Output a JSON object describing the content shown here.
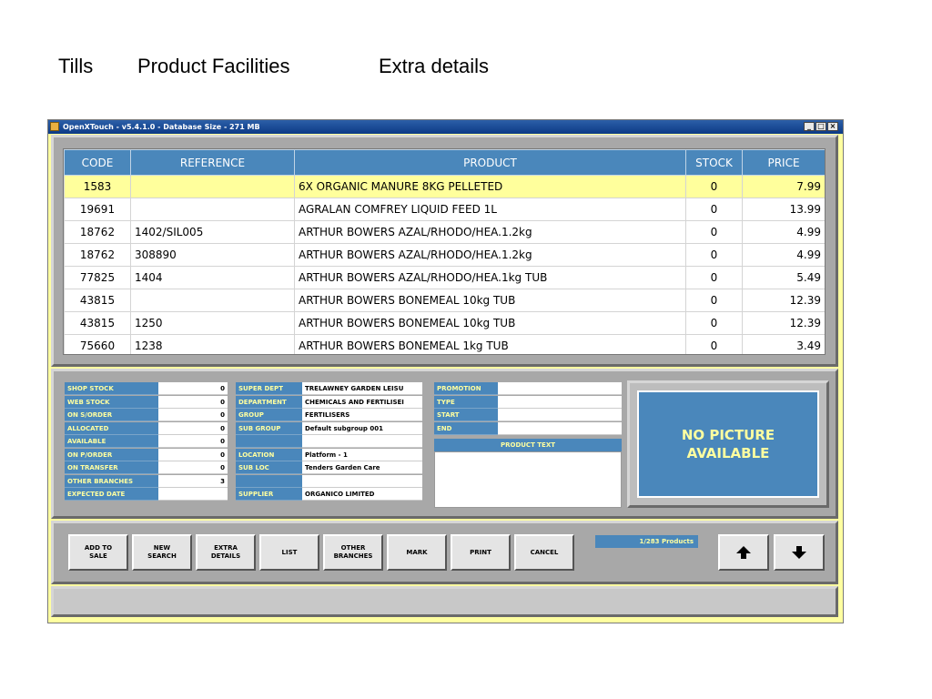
{
  "slide_tabs": [
    "Tills",
    "Product Facilities",
    "Extra details"
  ],
  "window": {
    "title": "OpenXTouch - v5.4.1.0 - Database Size - 271 MB",
    "controls": {
      "minimize": "_",
      "maximize": "□",
      "close": "×"
    }
  },
  "grid": {
    "columns": [
      "CODE",
      "REFERENCE",
      "PRODUCT",
      "STOCK",
      "PRICE"
    ],
    "selected_row": 0,
    "rows": [
      [
        "1583",
        "",
        "6X ORGANIC MANURE 8KG PELLETED",
        "0",
        "7.99"
      ],
      [
        "19691",
        "",
        "AGRALAN COMFREY LIQUID FEED 1L",
        "0",
        "13.99"
      ],
      [
        "18762",
        "1402/SIL005",
        "ARTHUR BOWERS AZAL/RHODO/HEA.1.2kg",
        "0",
        "4.99"
      ],
      [
        "18762",
        "308890",
        "ARTHUR BOWERS AZAL/RHODO/HEA.1.2kg",
        "0",
        "4.99"
      ],
      [
        "77825",
        "1404",
        "ARTHUR BOWERS AZAL/RHODO/HEA.1kg TUB",
        "0",
        "5.49"
      ],
      [
        "43815",
        "",
        "ARTHUR BOWERS BONEMEAL 10kg TUB",
        "0",
        "12.39"
      ],
      [
        "43815",
        "1250",
        "ARTHUR BOWERS BONEMEAL 10kg TUB",
        "0",
        "12.39"
      ],
      [
        "75660",
        "1238",
        "ARTHUR BOWERS BONEMEAL 1kg TUB",
        "0",
        "3.49"
      ]
    ]
  },
  "stock": [
    {
      "label": "SHOP STOCK",
      "value": "0"
    },
    {
      "label": "WEB STOCK",
      "value": "0"
    },
    {
      "label": "ON S/ORDER",
      "value": "0"
    },
    {
      "label": "ALLOCATED",
      "value": "0"
    },
    {
      "label": "AVAILABLE",
      "value": "0"
    },
    {
      "label": "ON P/ORDER",
      "value": "0"
    },
    {
      "label": "ON TRANSFER",
      "value": "0"
    },
    {
      "label": "OTHER BRANCHES",
      "value": "3"
    },
    {
      "label": "EXPECTED DATE",
      "value": ""
    }
  ],
  "category": [
    {
      "label": "SUPER DEPT",
      "value": "TRELAWNEY GARDEN LEISU"
    },
    {
      "label": "DEPARTMENT",
      "value": "CHEMICALS AND FERTILISEI"
    },
    {
      "label": "GROUP",
      "value": "FERTILISERS"
    },
    {
      "label": "SUB GROUP",
      "value": "Default subgroup 001"
    },
    {
      "label": "",
      "value": ""
    },
    {
      "label": "LOCATION",
      "value": "Platform - 1"
    },
    {
      "label": "SUB LOC",
      "value": "Tenders Garden Care"
    },
    {
      "label": "",
      "value": ""
    },
    {
      "label": "SUPPLIER",
      "value": "ORGANICO LIMITED"
    }
  ],
  "promotion": [
    {
      "label": "PROMOTION",
      "value": ""
    },
    {
      "label": "TYPE",
      "value": ""
    },
    {
      "label": "START",
      "value": ""
    },
    {
      "label": "END",
      "value": ""
    }
  ],
  "product_text": {
    "header": "PRODUCT TEXT",
    "value": ""
  },
  "picture_text": "NO PICTURE AVAILABLE",
  "buttons": [
    "ADD TO\nSALE",
    "NEW\nSEARCH",
    "EXTRA\nDETAILS",
    "LIST",
    "OTHER\nBRANCHES",
    "MARK",
    "PRINT",
    "CANCEL"
  ],
  "counter": "1/283 Products",
  "icons": {
    "up": "arrow-up-icon",
    "down": "arrow-down-icon"
  },
  "colors": {
    "window_bg": "#ffffa0",
    "header_blue": "#4a87bb",
    "selected_row": "#ffff9c",
    "panel_grey": "#a8a8a8"
  }
}
